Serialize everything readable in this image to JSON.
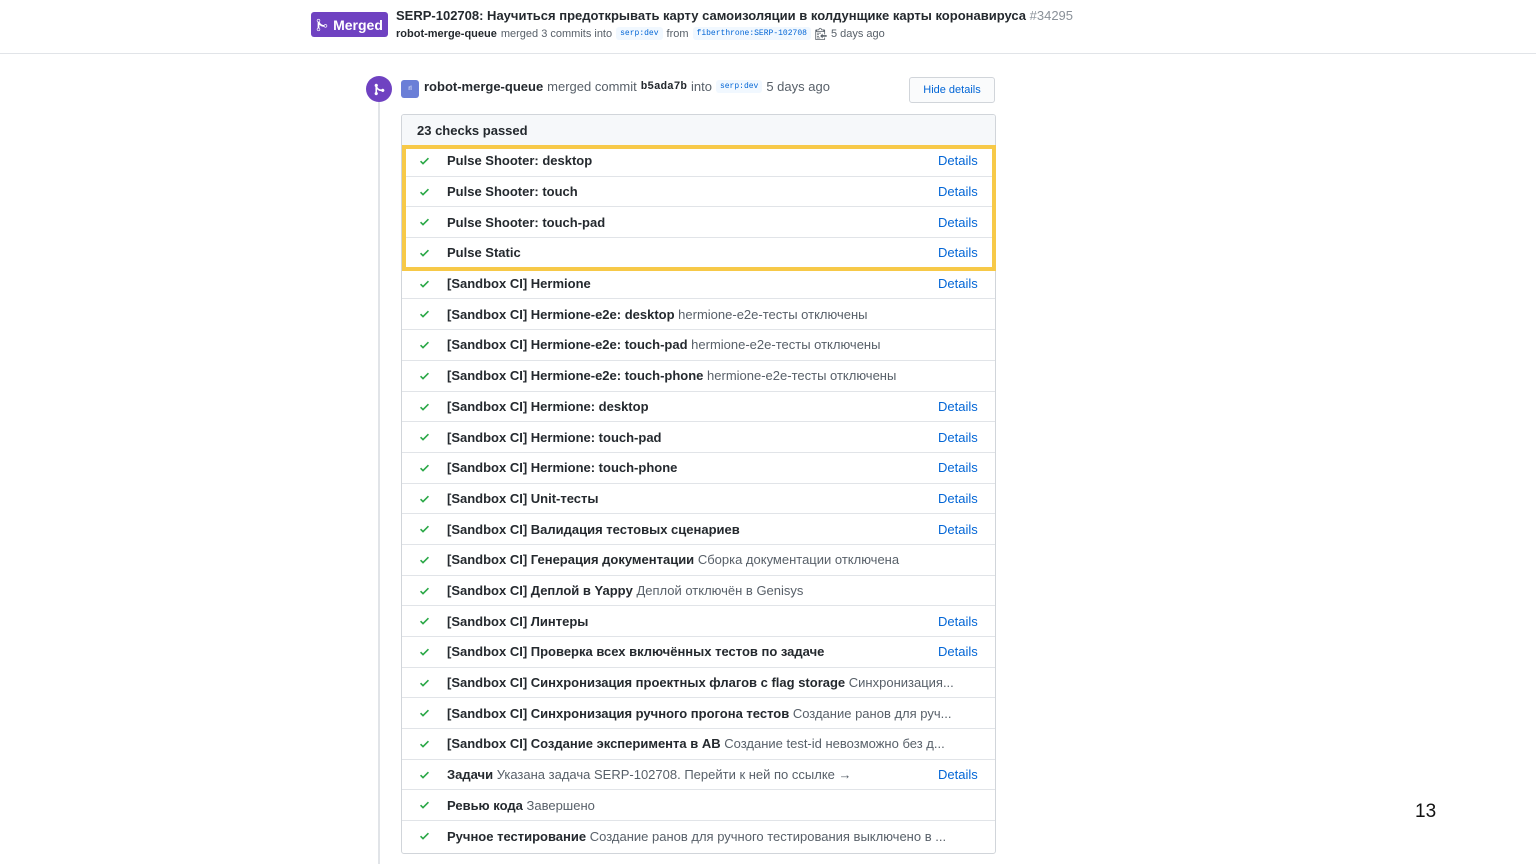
{
  "header": {
    "badge_label": "Merged",
    "title": "SERP-102708: Научиться предоткрывать карту самоизоляции в колдунщике карты коронавируса",
    "number": "#34295",
    "meta": {
      "author": "robot-merge-queue",
      "merged_text": "merged 3 commits into",
      "base_branch": "serp:dev",
      "from_text": "from",
      "head_branch": "fiberthrone:SERP-102708",
      "time": "5 days ago"
    }
  },
  "event": {
    "avatar_text": "rl",
    "author": "robot-merge-queue",
    "merged_commit_text": "merged commit",
    "sha": "b5ada7b",
    "into_text": "into",
    "branch": "serp:dev",
    "time": "5 days ago",
    "hide_details_label": "Hide details"
  },
  "checks": {
    "summary": "23 checks passed",
    "items": [
      {
        "name": "Pulse Shooter: desktop",
        "desc": "",
        "details": "Details"
      },
      {
        "name": "Pulse Shooter: touch",
        "desc": "",
        "details": "Details"
      },
      {
        "name": "Pulse Shooter: touch-pad",
        "desc": "",
        "details": "Details"
      },
      {
        "name": "Pulse Static",
        "desc": "",
        "details": "Details"
      },
      {
        "name": "[Sandbox CI] Hermione",
        "desc": "",
        "details": "Details"
      },
      {
        "name": "[Sandbox CI] Hermione-e2e: desktop",
        "desc": "hermione-e2e-тесты отключены",
        "details": ""
      },
      {
        "name": "[Sandbox CI] Hermione-e2e: touch-pad",
        "desc": "hermione-e2e-тесты отключены",
        "details": ""
      },
      {
        "name": "[Sandbox CI] Hermione-e2e: touch-phone",
        "desc": "hermione-e2e-тесты отключены",
        "details": ""
      },
      {
        "name": "[Sandbox CI] Hermione: desktop",
        "desc": "",
        "details": "Details"
      },
      {
        "name": "[Sandbox CI] Hermione: touch-pad",
        "desc": "",
        "details": "Details"
      },
      {
        "name": "[Sandbox CI] Hermione: touch-phone",
        "desc": "",
        "details": "Details"
      },
      {
        "name": "[Sandbox CI] Unit-тесты",
        "desc": "",
        "details": "Details"
      },
      {
        "name": "[Sandbox CI] Валидация тестовых сценариев",
        "desc": "",
        "details": "Details"
      },
      {
        "name": "[Sandbox CI] Генерация документации",
        "desc": "Сборка документации отключена",
        "details": ""
      },
      {
        "name": "[Sandbox CI] Деплой в Yappy",
        "desc": "Деплой отключён в Genisys",
        "details": ""
      },
      {
        "name": "[Sandbox CI] Линтеры",
        "desc": "",
        "details": "Details"
      },
      {
        "name": "[Sandbox CI] Проверка всех включённых тестов по задаче",
        "desc": "",
        "details": "Details"
      },
      {
        "name": "[Sandbox CI] Синхронизация проектных флагов с flag storage",
        "desc": "Синхронизация...",
        "details": ""
      },
      {
        "name": "[Sandbox CI] Синхронизация ручного прогона тестов",
        "desc": "Создание ранов для руч...",
        "details": ""
      },
      {
        "name": "[Sandbox CI] Создание эксперимента в AB",
        "desc": "Создание test-id невозможно без д...",
        "details": ""
      },
      {
        "name": "Задачи",
        "desc": "Указана задача SERP-102708. Перейти к ней по ссылке →",
        "details": "Details"
      },
      {
        "name": "Ревью кода",
        "desc": "Завершено",
        "details": ""
      },
      {
        "name": "Ручное тестирование",
        "desc": "Создание ранов для ручного тестирования выключено в ...",
        "details": ""
      }
    ]
  },
  "colors": {
    "merged_purple": "#6f42c1",
    "success_green": "#28a745",
    "link_blue": "#0366d6",
    "highlight_yellow": "#f7c948"
  },
  "page_number": "13"
}
